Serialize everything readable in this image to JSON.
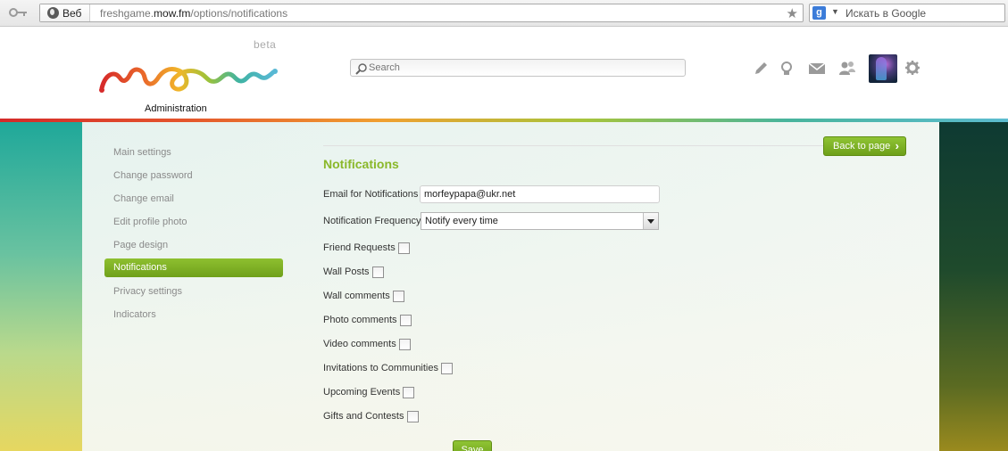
{
  "browser": {
    "site_badge": "Веб",
    "url_host_prefix": "freshgame.",
    "url_host_bold": "mow.fm",
    "url_path": "/options/notifications",
    "search_placeholder": "Искать в Google"
  },
  "header": {
    "beta_label": "beta",
    "admin_label": "Administration",
    "search_placeholder": "Search",
    "icons": [
      "pencil-icon",
      "lightbulb-icon",
      "mail-icon",
      "friends-icon",
      "gear-icon"
    ]
  },
  "sidebar": {
    "items": [
      {
        "label": "Main settings",
        "active": false
      },
      {
        "label": "Change password",
        "active": false
      },
      {
        "label": "Change email",
        "active": false
      },
      {
        "label": "Edit profile photo",
        "active": false
      },
      {
        "label": "Page design",
        "active": false
      },
      {
        "label": "Notifications",
        "active": true
      },
      {
        "label": "Privacy settings",
        "active": false
      },
      {
        "label": "Indicators",
        "active": false
      }
    ]
  },
  "main": {
    "back_button": "Back to page",
    "title": "Notifications",
    "email_label": "Email for Notifications",
    "email_value": "morfeypapa@ukr.net",
    "frequency_label": "Notification Frequency",
    "frequency_value": "Notify every time",
    "checkboxes": [
      {
        "label": "Friend Requests",
        "checked": false
      },
      {
        "label": "Wall Posts",
        "checked": false
      },
      {
        "label": "Wall comments",
        "checked": false
      },
      {
        "label": "Photo comments",
        "checked": false
      },
      {
        "label": "Video comments",
        "checked": false
      },
      {
        "label": "Invitations to Communities",
        "checked": false
      },
      {
        "label": "Upcoming Events",
        "checked": false
      },
      {
        "label": "Gifts and Contests",
        "checked": false
      }
    ],
    "save_button": "Save"
  },
  "colors": {
    "accent_green": "#7fb025",
    "title_green": "#8ab82a"
  }
}
